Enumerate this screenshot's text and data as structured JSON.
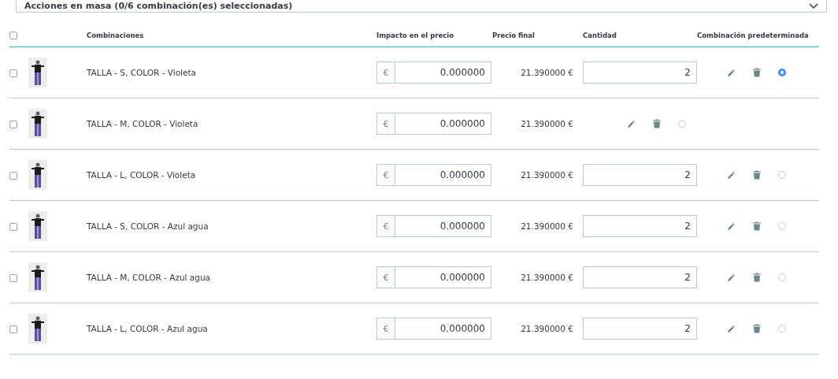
{
  "bulk_actions": {
    "label": "Acciones en masa (0/6 combinación(es) seleccionadas)",
    "expanded": false
  },
  "table": {
    "select_all": {
      "checked": false
    },
    "columns": [
      "Combinaciones",
      "Impacto en el precio",
      "Precio final",
      "Cantidad",
      "Combinación predeterminada"
    ],
    "rows": [
      {
        "checked": false,
        "name": "TALLA - S, COLOR - Violeta",
        "currency": "€",
        "impact": "0.000000",
        "final_price": "21.390000 €",
        "quantity": "2",
        "selected": true
      },
      {
        "checked": false,
        "name": "TALLA - M, COLOR - Violeta",
        "currency": "€",
        "impact": "0.000000",
        "final_price": "21.390000 €",
        "selected": false
      },
      {
        "checked": false,
        "name": "TALLA - L, COLOR - Violeta",
        "currency": "€",
        "impact": "0.000000",
        "final_price": "21.390000 €",
        "quantity": "2",
        "selected": false
      },
      {
        "checked": false,
        "name": "TALLA - S, COLOR - Azul agua",
        "currency": "€",
        "impact": "0.000000",
        "final_price": "21.390000 €",
        "quantity": "2",
        "selected": false
      },
      {
        "checked": false,
        "name": "TALLA - M, COLOR - Azul agua",
        "currency": "€",
        "impact": "0.000000",
        "final_price": "21.390000 €",
        "quantity": "2",
        "selected": false
      },
      {
        "checked": false,
        "name": "TALLA - L, COLOR - Azul agua",
        "currency": "€",
        "impact": "0.000000",
        "final_price": "21.390000 €",
        "quantity": "2",
        "selected": false
      }
    ]
  }
}
